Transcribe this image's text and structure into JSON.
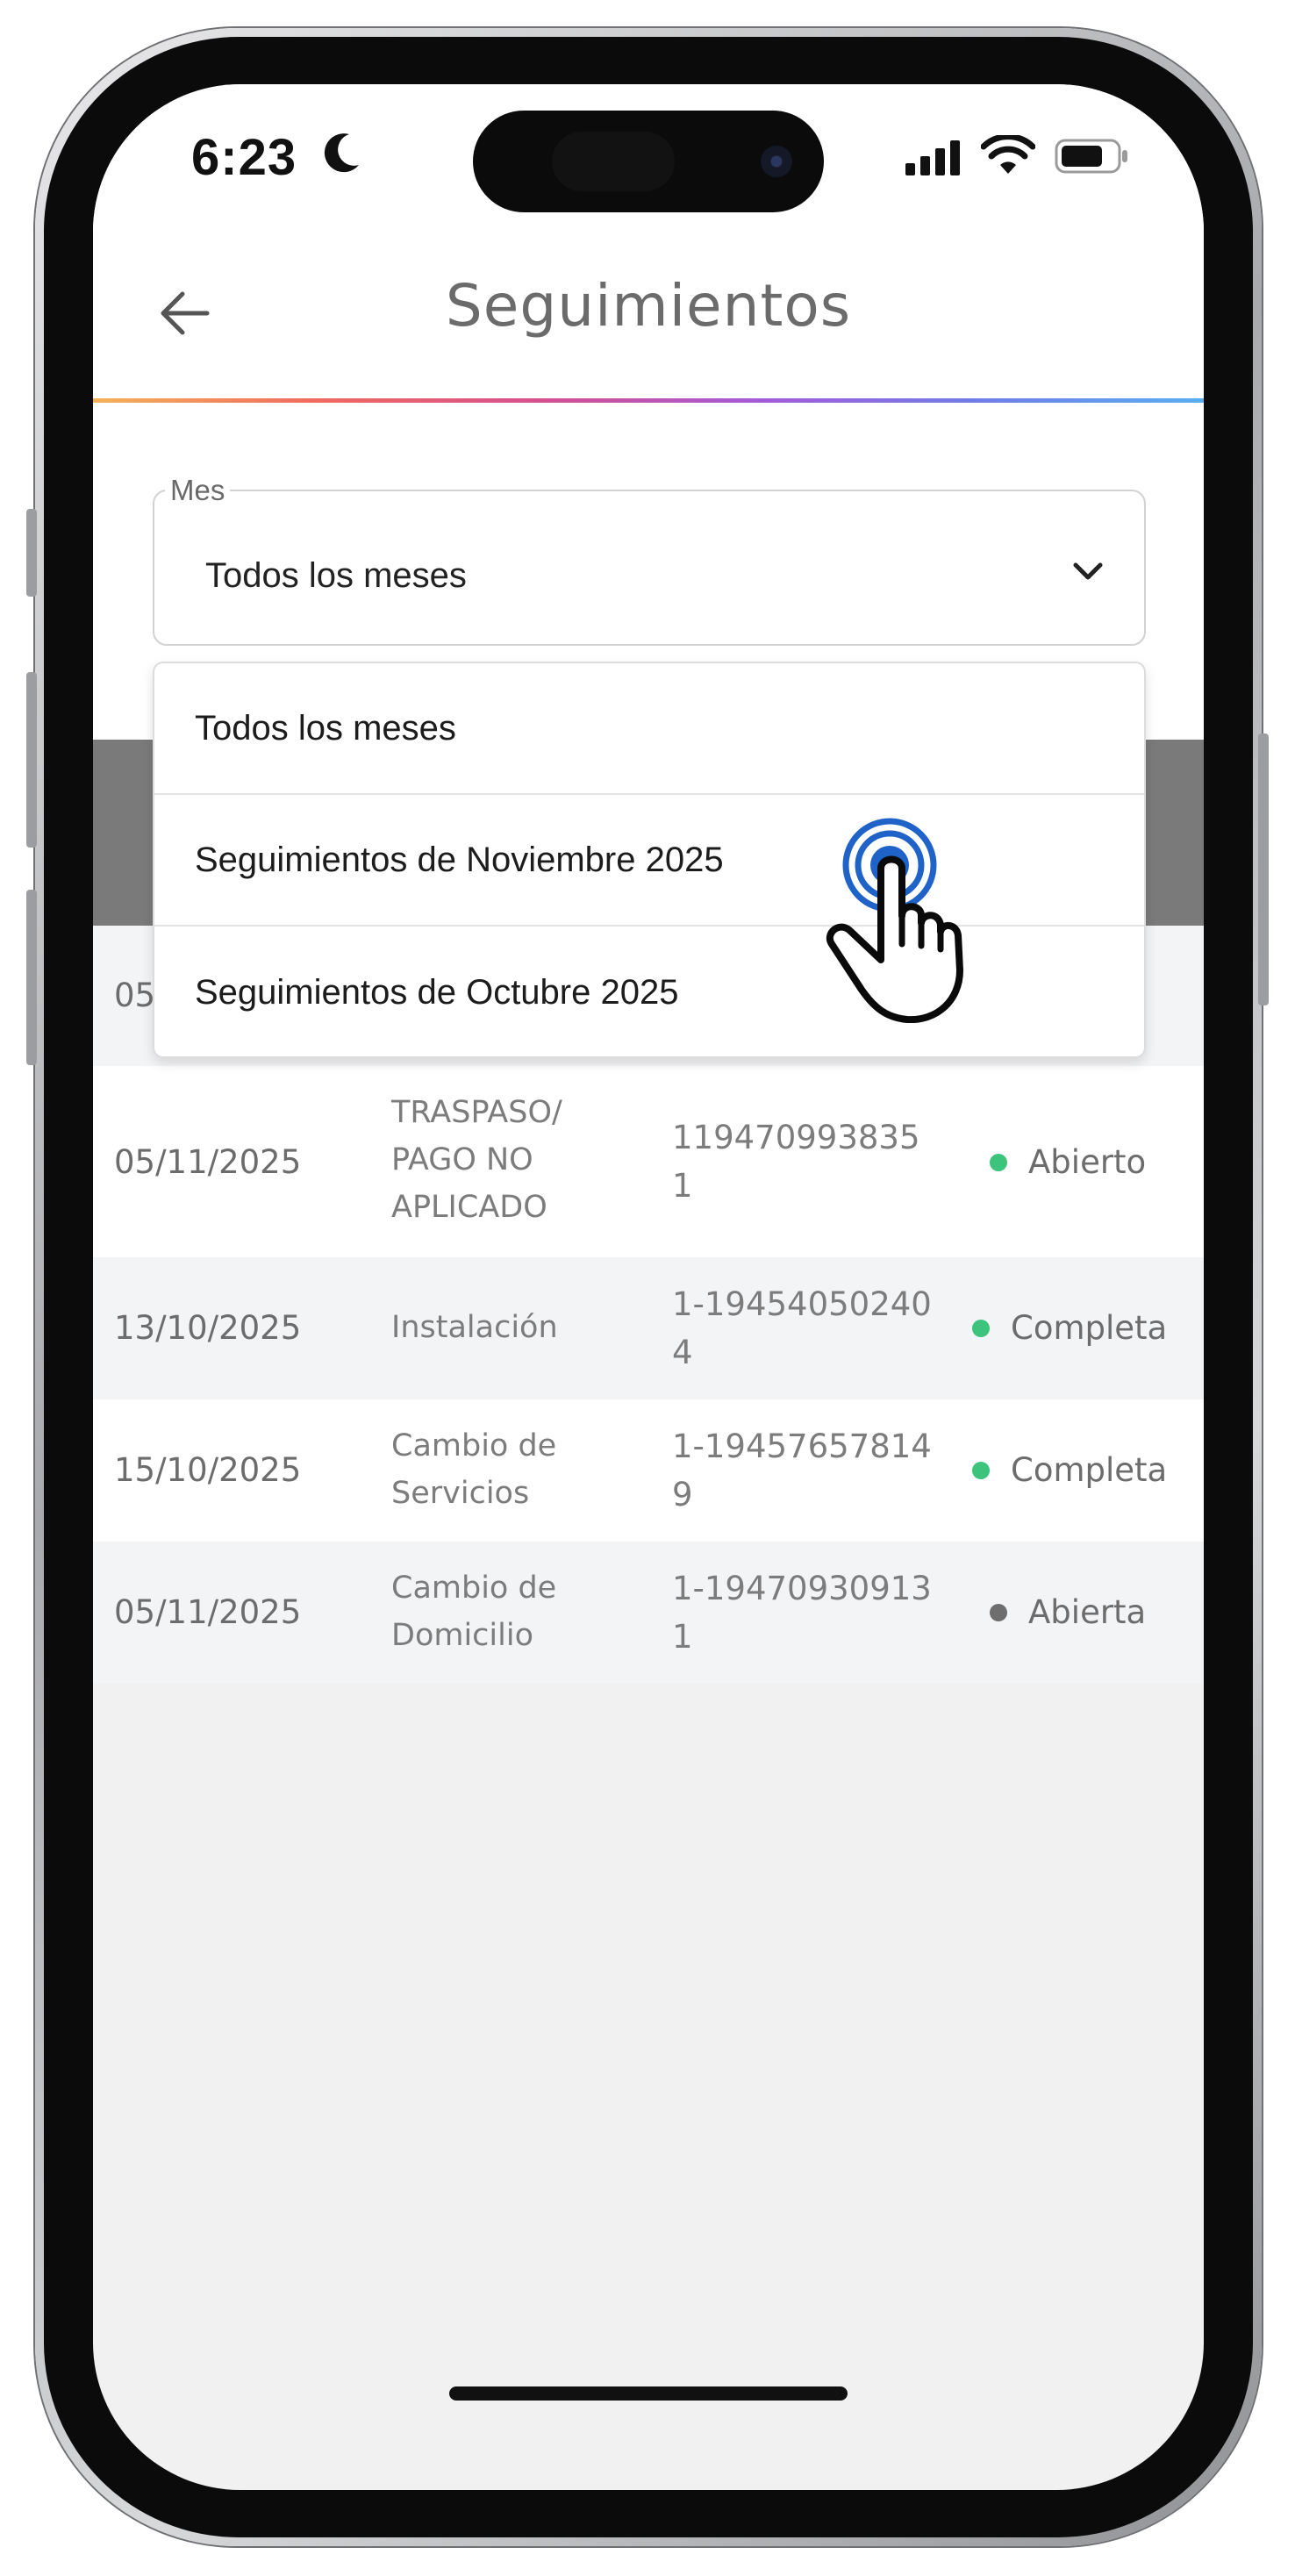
{
  "status_bar": {
    "time": "6:23",
    "icons": [
      "moon-icon",
      "signal-icon",
      "wifi-icon",
      "battery-icon"
    ]
  },
  "header": {
    "title": "Seguimientos",
    "back_icon": "arrow-left-icon"
  },
  "filter": {
    "legend": "Mes",
    "selected": "Todos los meses",
    "options": [
      "Todos los meses",
      "Seguimientos de Noviembre 2025",
      "Seguimientos de Octubre 2025"
    ]
  },
  "table": {
    "partial_row_date": "05",
    "rows": [
      {
        "date": "05/11/2025",
        "type": "TRASPASO/ PAGO NO APLICADO",
        "id": "1194709938351",
        "status": "Abierto",
        "status_color": "#3cc47c"
      },
      {
        "date": "13/10/2025",
        "type": "Instalación",
        "id": "1-194540502404",
        "status": "Completa",
        "status_color": "#3cc47c"
      },
      {
        "date": "15/10/2025",
        "type": "Cambio de Servicios",
        "id": "1-194576578149",
        "status": "Completa",
        "status_color": "#3cc47c"
      },
      {
        "date": "05/11/2025",
        "type": "Cambio de Domicilio",
        "id": "1-194709309131",
        "status": "Abierta",
        "status_color": "#6e6e6e"
      }
    ]
  },
  "colors": {
    "accent_blue": "#1f63c8",
    "status_green": "#3cc47c",
    "status_gray": "#6e6e6e"
  }
}
